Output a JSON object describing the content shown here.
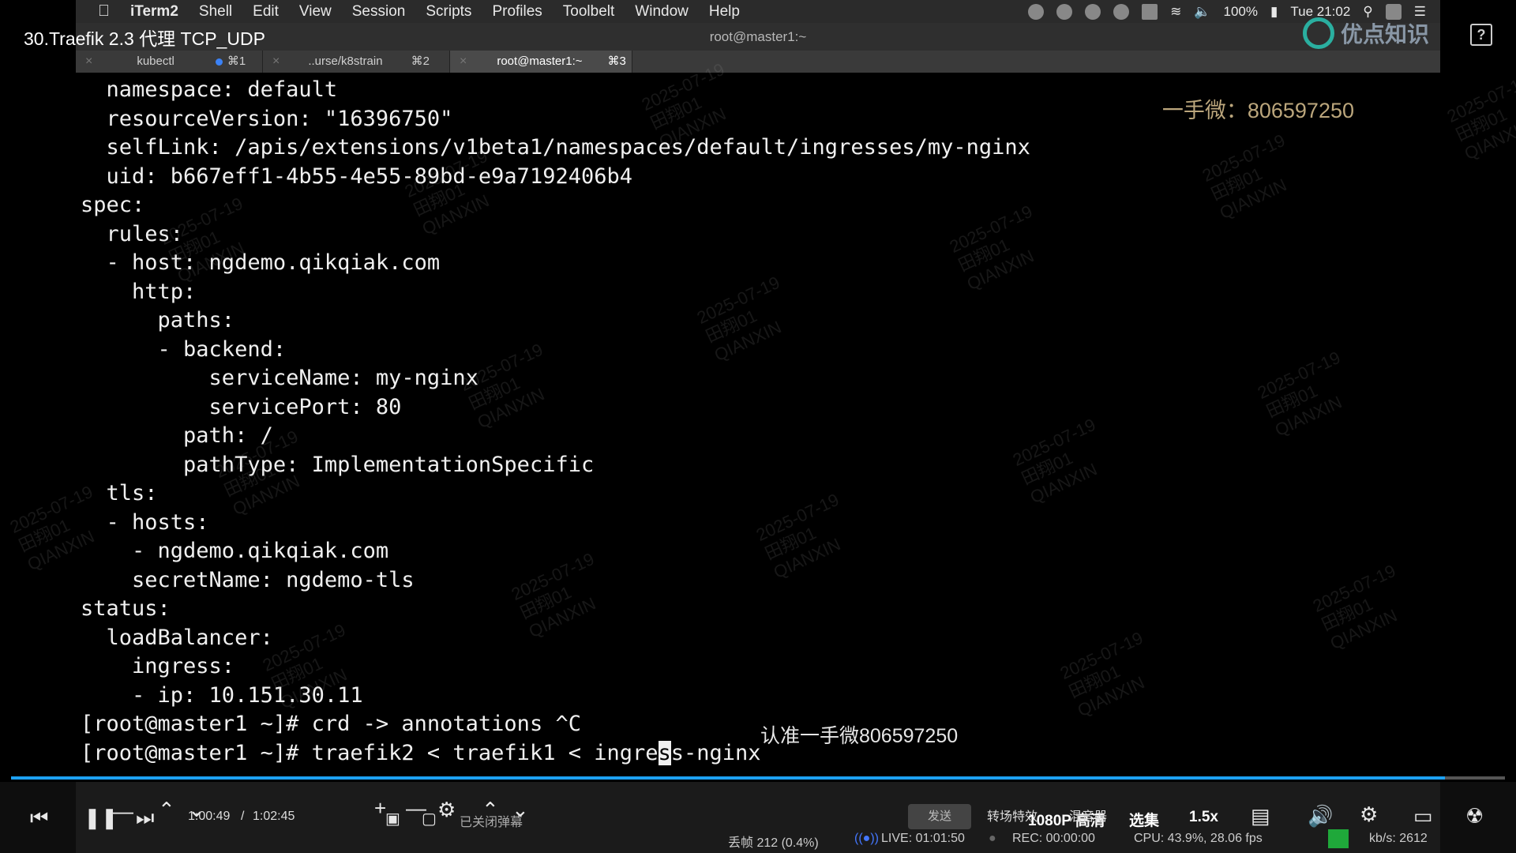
{
  "video": {
    "title": "30.Traefik 2.3 代理 TCP_UDP",
    "brand": "优点知识"
  },
  "menubar": {
    "app": "iTerm2",
    "items": [
      "Shell",
      "Edit",
      "View",
      "Session",
      "Scripts",
      "Profiles",
      "Toolbelt",
      "Window",
      "Help"
    ],
    "battery": "100%",
    "clock": "Tue 21:02"
  },
  "window": {
    "title": "root@master1:~"
  },
  "tabs": [
    {
      "label": "kubectl",
      "shortcut": "⌘1",
      "dot": true
    },
    {
      "label": "..urse/k8strain",
      "shortcut": "⌘2"
    },
    {
      "label": "root@master1:~",
      "shortcut": "⌘3",
      "active": true
    }
  ],
  "terminal": {
    "lines": [
      "  namespace: default",
      "  resourceVersion: \"16396750\"",
      "  selfLink: /apis/extensions/v1beta1/namespaces/default/ingresses/my-nginx",
      "  uid: b667eff1-4b55-4e55-89bd-e9a7192406b4",
      "spec:",
      "  rules:",
      "  - host: ngdemo.qikqiak.com",
      "    http:",
      "      paths:",
      "      - backend:",
      "          serviceName: my-nginx",
      "          servicePort: 80",
      "        path: /",
      "        pathType: ImplementationSpecific",
      "  tls:",
      "  - hosts:",
      "    - ngdemo.qikqiak.com",
      "    secretName: ngdemo-tls",
      "status:",
      "  loadBalancer:",
      "    ingress:",
      "    - ip: 10.151.30.11",
      "[root@master1 ~]# crd -> annotations ^C"
    ],
    "prompt_before_cursor": "[root@master1 ~]# traefik2 < traefik1 < ingre",
    "cursor_char": "s",
    "prompt_after_cursor": "s-nginx"
  },
  "overlays": {
    "wechat_top": "一手微：806597250",
    "wechat_bottom": "认准一手微806597250",
    "watermark": "2025-07-19\n田翔01\nQIANXIN"
  },
  "player": {
    "progress": 0.96,
    "current_time": "1:00:49",
    "separator": "/",
    "duration": "1:02:45",
    "danmaku_status": "已关闭弹幕",
    "send_label": "发送",
    "transition_label": "转场特效",
    "quality_label": "1080P 高清",
    "other_label": "混音器",
    "episodes_label": "选集",
    "speed_label": "1.5x",
    "dropped_frames": "丢帧 212 (0.4%)",
    "live": "LIVE: 01:01:50",
    "rec": "REC: 00:00:00",
    "cpu": "CPU: 43.9%, 28.06 fps",
    "bitrate": "kb/s: 2612"
  }
}
